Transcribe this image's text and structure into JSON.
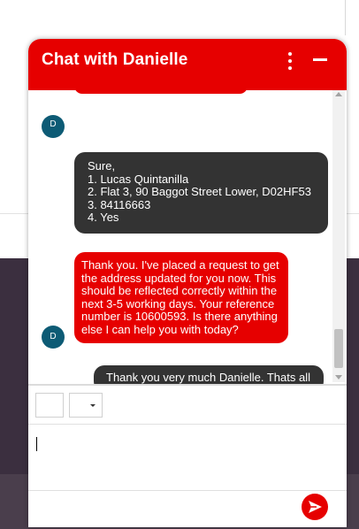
{
  "chat": {
    "title": "Chat with Danielle",
    "avatar_initial": "D",
    "messages": [
      {
        "sender": "agent",
        "text": ""
      },
      {
        "sender": "user",
        "text": "Sure,\n1. Lucas Quintanilla\n2. Flat 3, 90 Baggot Street Lower, D02HF53\n3. 84116663\n4. Yes"
      },
      {
        "sender": "agent",
        "text": "Thank you. I've placed a request to get\nthe address updated for you now. This\nshould be reflected correctly within the\nnext 3-5 working days. Your reference\nnumber is 10600593. Is there anything\nelse I can help you with today?"
      },
      {
        "sender": "user",
        "text": "Thank you very much Danielle. Thats all"
      }
    ]
  },
  "composer": {
    "value": "",
    "placeholder": ""
  },
  "colors": {
    "brand": "#e60000",
    "user_bubble": "#333333",
    "avatar": "#0d5b75"
  },
  "icons": {
    "menu": "kebab-menu-icon",
    "minimize": "minimize-icon",
    "send": "send-icon"
  }
}
